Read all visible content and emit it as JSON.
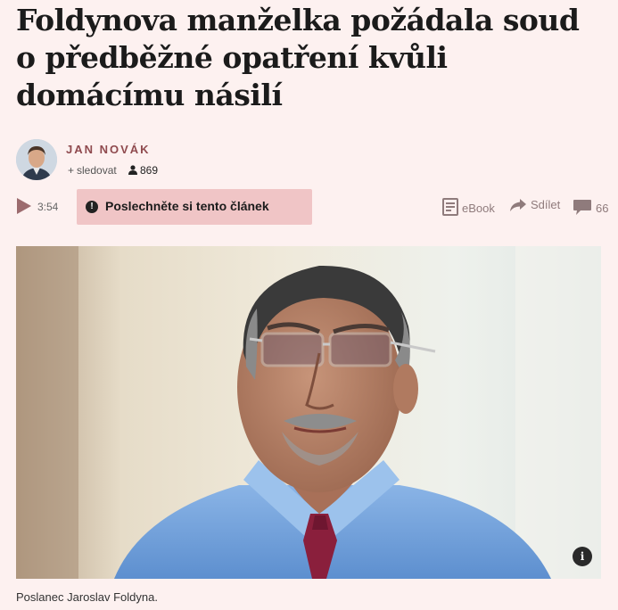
{
  "article": {
    "title": "Foldynova manželka požádala soud o předběžné opatření kvůli domácímu násilí"
  },
  "author": {
    "name": "JAN NOVÁK",
    "follow_label": "sledovat",
    "followers": "869"
  },
  "audio": {
    "duration": "3:54",
    "listen_label": "Poslechněte si tento článek"
  },
  "tools": {
    "ebook_label": "eBook",
    "share_label": "Sdílet",
    "comments_count": "66"
  },
  "photo": {
    "info_symbol": "i",
    "caption": "Poslanec Jaroslav Foldyna."
  },
  "colors": {
    "background": "#fdf1f0",
    "accent": "#8f4a4e",
    "listen_button": "#f0c5c6",
    "shirt": "#6f9fd6",
    "tie": "#8a1f3c"
  }
}
